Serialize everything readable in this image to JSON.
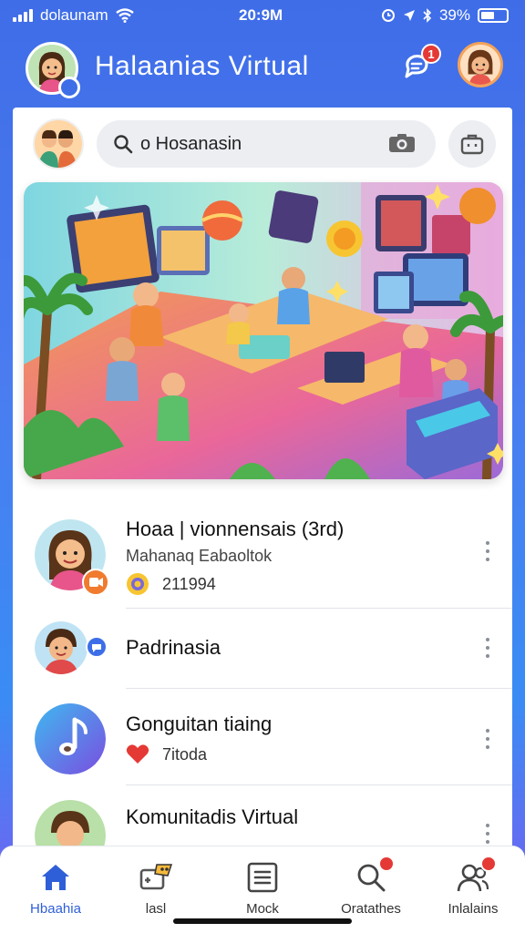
{
  "status_bar": {
    "carrier": "dolaunam",
    "time": "20:9M",
    "battery": "39%"
  },
  "header": {
    "title": "Halaanias Virtual",
    "notification_count": "1"
  },
  "search": {
    "placeholder": "o Hosanasin"
  },
  "hero_image": {
    "description_icon": "virtual-community-illustration"
  },
  "list": {
    "items": [
      {
        "title": "Hoaa | vionnensais (3rd)",
        "subtitle": "Mahanaq Eabaoltok",
        "meta": "211994",
        "meta_icon": "coin-icon"
      },
      {
        "title": "Padrinasia"
      },
      {
        "title": "Gonguitan tiaing",
        "meta": "7itoda",
        "meta_icon": "heart-icon"
      },
      {
        "title": "Komunitadis Virtual"
      }
    ]
  },
  "bottom_nav": {
    "items": [
      {
        "label": "Hbaahia",
        "icon": "home-icon"
      },
      {
        "label": "lasl",
        "icon": "games-icon"
      },
      {
        "label": "Mock",
        "icon": "list-icon"
      },
      {
        "label": "Oratathes",
        "icon": "search-icon"
      },
      {
        "label": "Inlalains",
        "icon": "people-icon"
      }
    ]
  },
  "colors": {
    "accent": "#2f5fd8",
    "header_bg": "#3f6de8",
    "badge": "#e53935"
  }
}
